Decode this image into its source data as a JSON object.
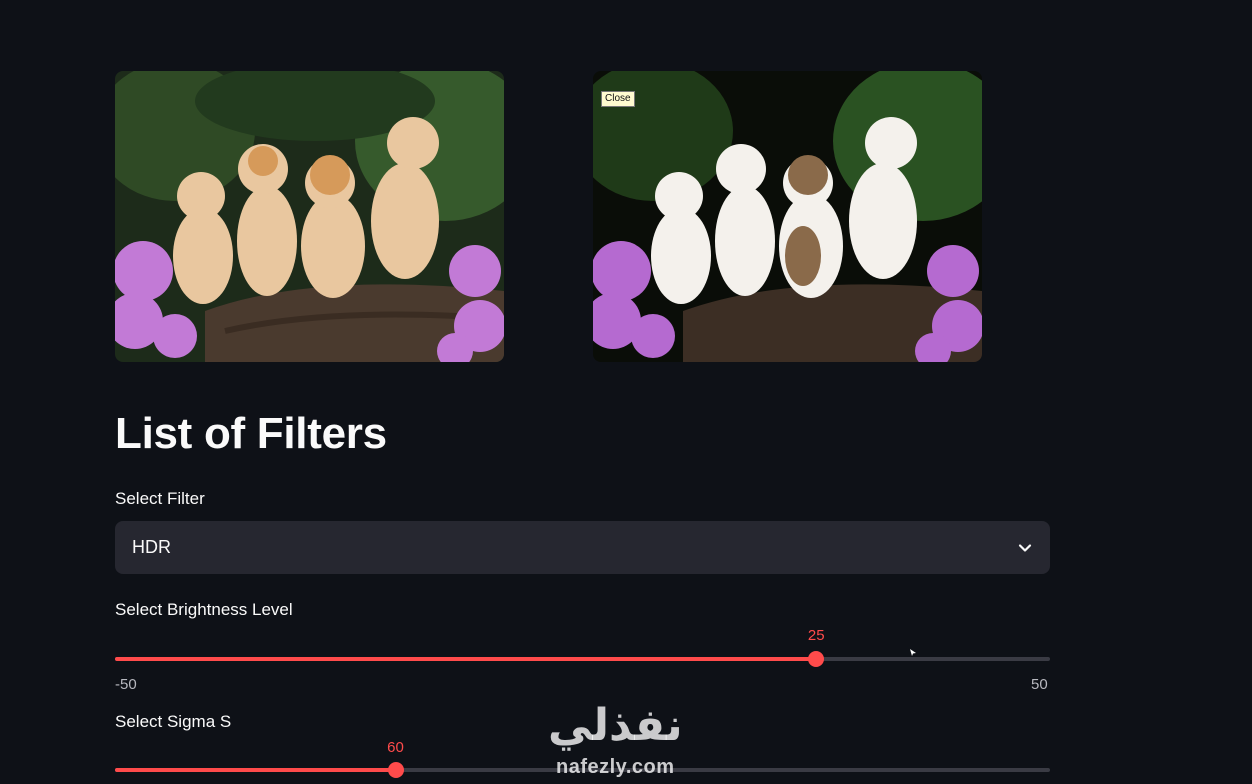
{
  "images": {
    "original": {
      "subject": "four kittens on a log with purple flowers"
    },
    "filtered": {
      "subject": "four kittens on a log with purple flowers, HDR filtered",
      "tooltip": "Close"
    }
  },
  "heading": "List of Filters",
  "filter_select": {
    "label": "Select Filter",
    "value": "HDR",
    "icon": "chevron-down-icon"
  },
  "sliders": [
    {
      "label": "Select Brightness Level",
      "value": "25",
      "min": "-50",
      "max": "50",
      "fraction": 0.75
    },
    {
      "label": "Select Sigma S",
      "value": "60",
      "fraction": 0.3
    }
  ],
  "watermark": {
    "arabic": "نفذلي",
    "latin": "nafezly.com"
  },
  "colors": {
    "background": "#0e1117",
    "accent": "#ff4b4b",
    "select_bg": "#262730"
  }
}
